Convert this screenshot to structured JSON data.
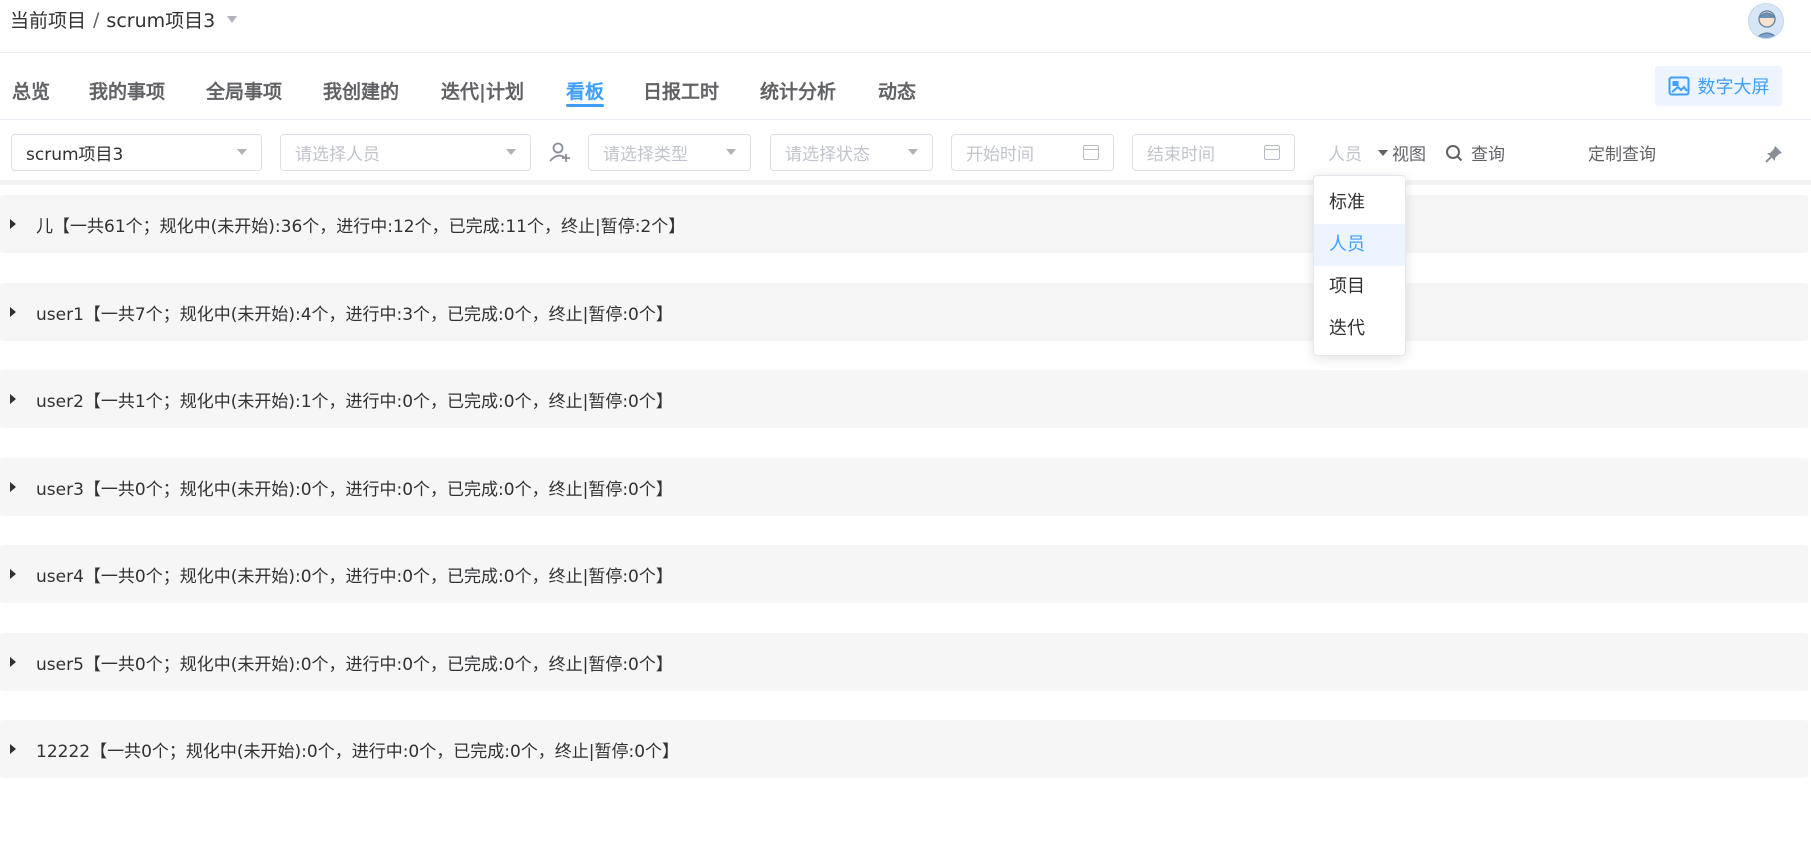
{
  "header": {
    "breadcrumb_root": "当前项目",
    "breadcrumb_sep": "/",
    "project_name": "scrum项目3"
  },
  "tabs": [
    {
      "label": "总览"
    },
    {
      "label": "我的事项"
    },
    {
      "label": "全局事项"
    },
    {
      "label": "我创建的"
    },
    {
      "label": "迭代|计划"
    },
    {
      "label": "看板"
    },
    {
      "label": "日报工时"
    },
    {
      "label": "统计分析"
    },
    {
      "label": "动态"
    }
  ],
  "active_tab": "看板",
  "big_screen_label": "数字大屏",
  "filters": {
    "project_value": "scrum项目3",
    "person_placeholder": "请选择人员",
    "type_placeholder": "请选择类型",
    "status_placeholder": "请选择状态",
    "start_placeholder": "开始时间",
    "end_placeholder": "结束时间",
    "view_value": "人员",
    "view_label": "视图",
    "query_label": "查询",
    "custom_query_label": "定制查询"
  },
  "groups": [
    {
      "text": "儿【一共61个；规化中(未开始):36个，进行中:12个，已完成:11个，终止|暂停:2个】"
    },
    {
      "text": "user1【一共7个；规化中(未开始):4个，进行中:3个，已完成:0个，终止|暂停:0个】"
    },
    {
      "text": "user2【一共1个；规化中(未开始):1个，进行中:0个，已完成:0个，终止|暂停:0个】"
    },
    {
      "text": "user3【一共0个；规化中(未开始):0个，进行中:0个，已完成:0个，终止|暂停:0个】"
    },
    {
      "text": "user4【一共0个；规化中(未开始):0个，进行中:0个，已完成:0个，终止|暂停:0个】"
    },
    {
      "text": "user5【一共0个；规化中(未开始):0个，进行中:0个，已完成:0个，终止|暂停:0个】"
    },
    {
      "text": "12222【一共0个；规化中(未开始):0个，进行中:0个，已完成:0个，终止|暂停:0个】"
    }
  ],
  "view_dropdown": {
    "options": [
      {
        "label": "标准"
      },
      {
        "label": "人员"
      },
      {
        "label": "项目"
      },
      {
        "label": "迭代"
      }
    ],
    "selected": "人员"
  },
  "colors": {
    "accent": "#409eff",
    "row_bg": "#f6f6f7"
  }
}
